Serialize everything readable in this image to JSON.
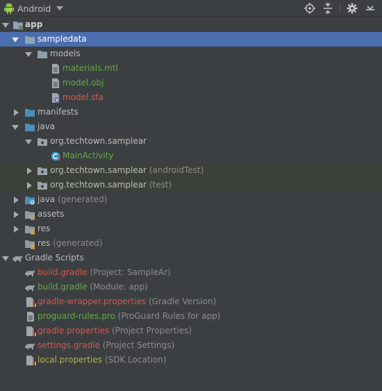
{
  "toolbar": {
    "view_label": "Android",
    "icons": [
      "android-icon",
      "dropdown-caret-icon",
      "locate-icon",
      "collapse-all-icon",
      "settings-icon",
      "hide-icon"
    ]
  },
  "colors": {
    "selection": "#4b6eaf",
    "highlight": "#3b4139",
    "file_green": "#62a947",
    "file_red": "#d4564a",
    "file_olive": "#b5b24a",
    "folder_blue": "#4a90b8"
  },
  "tree": {
    "app": "app",
    "sampledata": "sampledata",
    "models": "models",
    "materials": "materials.mtl",
    "model_obj": "model.obj",
    "model_sfa": "model.sfa",
    "manifests": "manifests",
    "java": "java",
    "pkg_main": "org.techtown.samplear",
    "main_activity": "MainActivity",
    "pkg_android_test": "org.techtown.samplear",
    "pkg_android_test_qualifier": "(androidTest)",
    "pkg_test": "org.techtown.samplear",
    "pkg_test_qualifier": "(test)",
    "java_gen": "java",
    "java_gen_qualifier": "(generated)",
    "assets": "assets",
    "res": "res",
    "res_gen": "res",
    "res_gen_qualifier": "(generated)",
    "gradle_scripts": "Gradle Scripts",
    "build_gradle_project": "build.gradle",
    "build_gradle_project_qualifier": "(Project: SampleAr)",
    "build_gradle_module": "build.gradle",
    "build_gradle_module_qualifier": "(Module: app)",
    "wrapper_props": "gradle-wrapper.properties",
    "wrapper_props_qualifier": "(Gradle Version)",
    "proguard": "proguard-rules.pro",
    "proguard_qualifier": "(ProGuard Rules for app)",
    "gradle_props": "gradle.properties",
    "gradle_props_qualifier": "(Project Properties)",
    "settings_gradle": "settings.gradle",
    "settings_gradle_qualifier": "(Project Settings)",
    "local_props": "local.properties",
    "local_props_qualifier": "(SDK Location)"
  }
}
